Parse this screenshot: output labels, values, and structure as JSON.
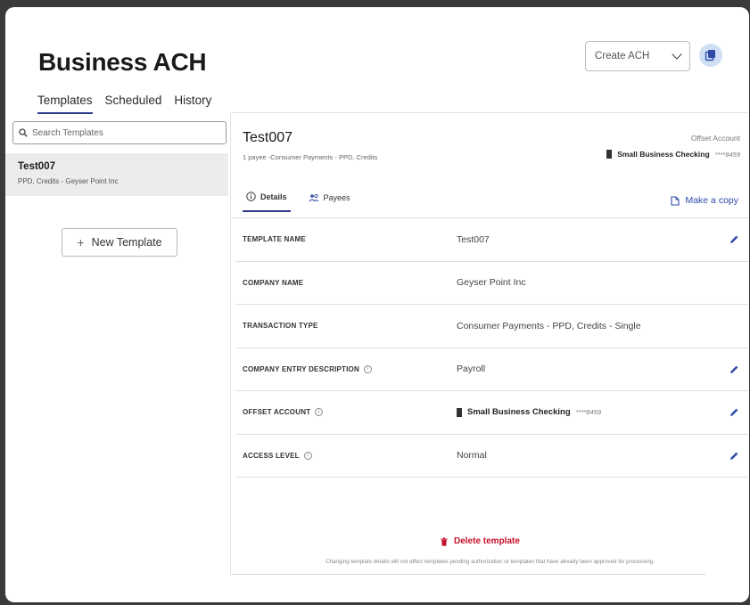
{
  "app": {
    "title": "Business ACH"
  },
  "nav": {
    "tabs": [
      {
        "label": "Templates"
      },
      {
        "label": "Scheduled"
      },
      {
        "label": "History"
      }
    ]
  },
  "header": {
    "create_select": "Create ACH"
  },
  "sidebar": {
    "search_placeholder": "Search Templates",
    "templates": [
      {
        "name": "Test007",
        "subtitle": "PPD, Credits - Geyser Point Inc"
      }
    ],
    "new_template_label": "New Template"
  },
  "template": {
    "name": "Test007",
    "summary": "1 payee -Consumer Payments - PPD, Credits",
    "offset": {
      "label": "Offset Account",
      "account_name": "Small Business Checking",
      "account_mask": "****8459"
    },
    "tabs": [
      {
        "label": "Details"
      },
      {
        "label": "Payees"
      }
    ],
    "make_copy_label": "Make a copy",
    "fields": [
      {
        "label": "TEMPLATE NAME",
        "value": "Test007"
      },
      {
        "label": "COMPANY NAME",
        "value": "Geyser Point Inc"
      },
      {
        "label": "TRANSACTION TYPE",
        "value": "Consumer Payments - PPD, Credits - Single"
      },
      {
        "label": "COMPANY ENTRY DESCRIPTION",
        "value": "Payroll"
      },
      {
        "label": "OFFSET ACCOUNT",
        "account_name": "Small Business Checking",
        "account_mask": "****8459"
      },
      {
        "label": "ACCESS LEVEL",
        "value": "Normal"
      }
    ],
    "delete_label": "Delete template",
    "footnote": "Changing template details will not affect templates pending authorization or templates that have already been approved for processing."
  },
  "colors": {
    "accent": "#2e3a8c",
    "link": "#2e4ba8",
    "danger": "#c8102e",
    "selected_bg": "#ececec"
  }
}
